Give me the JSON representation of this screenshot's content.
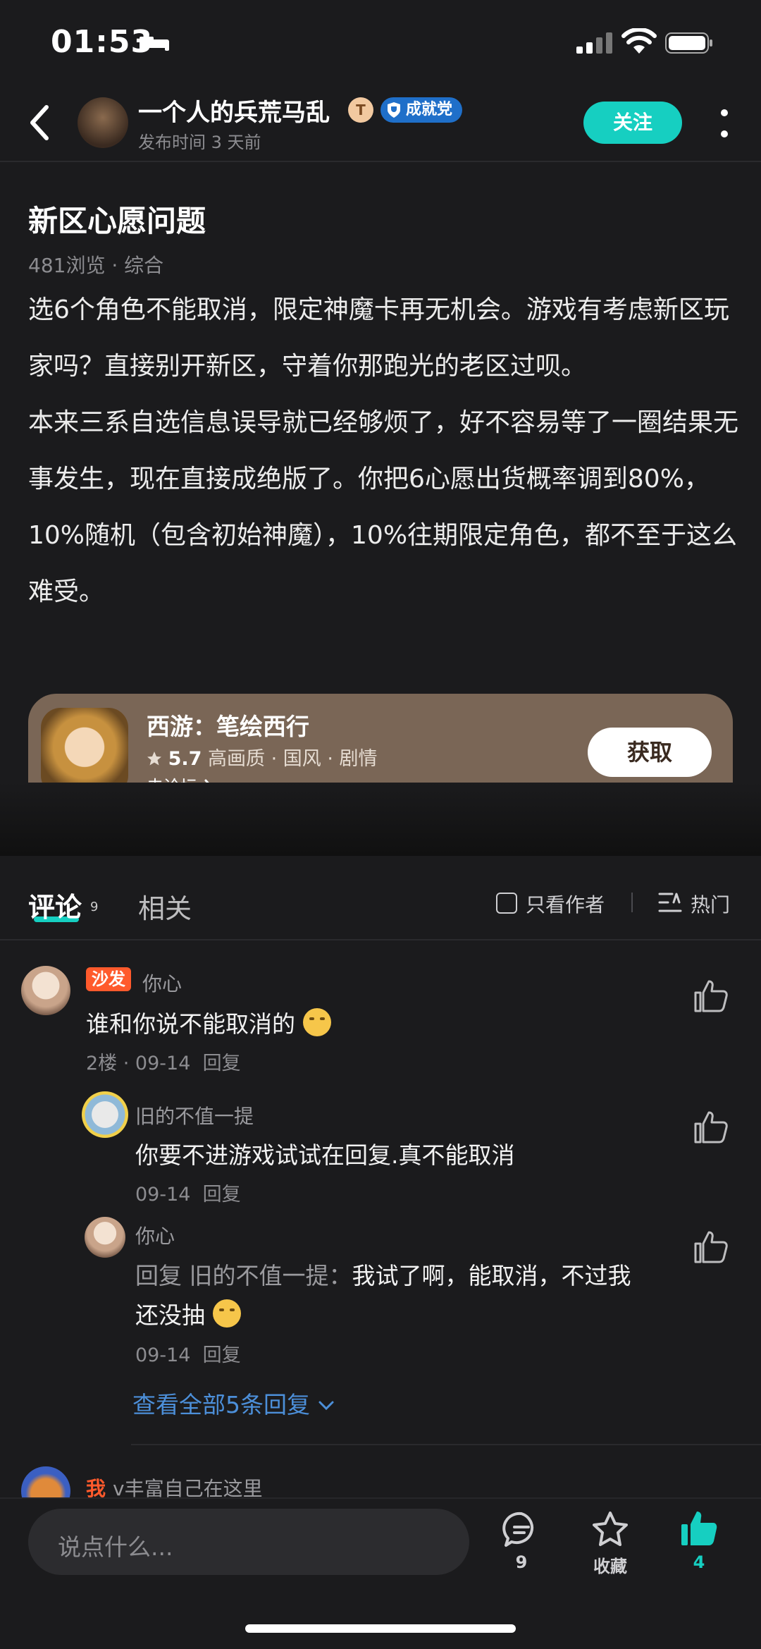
{
  "status_bar": {
    "time": "01:53"
  },
  "header": {
    "author": "一个人的兵荒马乱",
    "level_badge": "T",
    "honor_badge": "成就党",
    "publish_time": "发布时间 3 天前",
    "follow_label": "关注"
  },
  "post": {
    "title": "新区心愿问题",
    "meta": "481浏览 · 综合",
    "body": "选6个角色不能取消，限定神魔卡再无机会。游戏有考虑新区玩家吗？直接别开新区，守着你那跑光的老区过呗。\n本来三系自选信息误导就已经够烦了，好不容易等了一圈结果无事发生，现在直接成绝版了。你把6心愿出货概率调到80%，10%随机（包含初始神魔），10%往期限定角色，都不至于这么难受。"
  },
  "game_card": {
    "name": "西游：笔绘西行",
    "rating": "5.7",
    "tags": "高画质 · 国风 · 剧情",
    "forum_link": "去论坛",
    "get_label": "获取"
  },
  "tabs": {
    "comments_label": "评论",
    "comments_count": "9",
    "related_label": "相关",
    "only_author": "只看作者",
    "sort_label": "热门"
  },
  "comments": [
    {
      "badge": "沙发",
      "user": "你心",
      "text": "谁和你说不能取消的",
      "meta": "2楼 · 09-14",
      "reply_label": "回复",
      "replies": [
        {
          "user": "旧的不值一提",
          "text": "你要不进游戏试试在回复.真不能取消",
          "meta": "09-14",
          "reply_label": "回复"
        },
        {
          "user": "你心",
          "reply_prefix": "回复 旧的不值一提：",
          "text_line1": "我试了啊，能取消，不过我",
          "text_line2": "还没抽",
          "meta": "09-14",
          "reply_label": "回复"
        }
      ],
      "view_all": "查看全部5条回复"
    },
    {
      "flag": "我",
      "user": "v丰富自己在这里"
    }
  ],
  "bottom_bar": {
    "placeholder": "说点什么...",
    "comment_count": "9",
    "favorite_label": "收藏",
    "like_count": "4"
  },
  "colors": {
    "accent": "#16cfc1",
    "sofa": "#ff5a2c",
    "link": "#4c8fd9",
    "card": "#7a6656"
  }
}
